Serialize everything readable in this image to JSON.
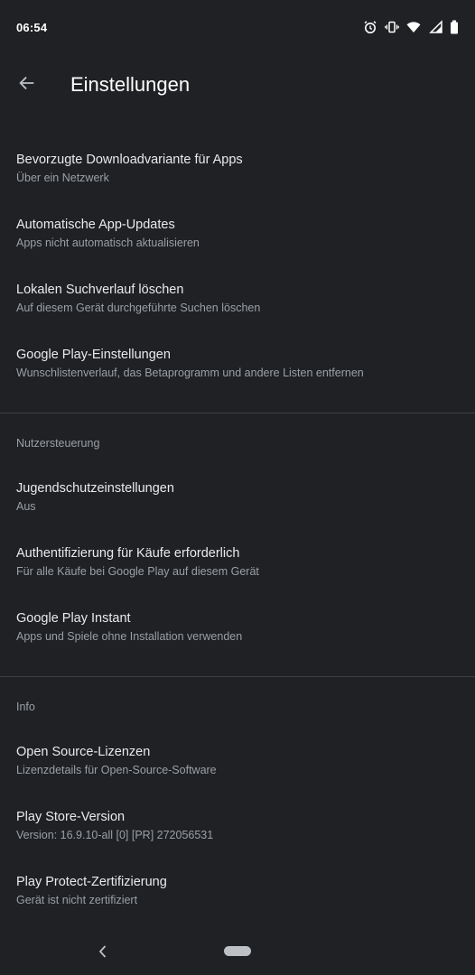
{
  "status_bar": {
    "time": "06:54",
    "icons": [
      "alarm-icon",
      "vibrate-icon",
      "wifi-icon",
      "signal-icon",
      "battery-icon"
    ]
  },
  "app_bar": {
    "title": "Einstellungen",
    "back_icon": "arrow-back-icon"
  },
  "group_general": [
    {
      "title": "Bevorzugte Downloadvariante für Apps",
      "subtitle": "Über ein Netzwerk"
    },
    {
      "title": "Automatische App-Updates",
      "subtitle": "Apps nicht automatisch aktualisieren"
    },
    {
      "title": "Lokalen Suchverlauf löschen",
      "subtitle": "Auf diesem Gerät durchgeführte Suchen löschen"
    },
    {
      "title": "Google Play-Einstellungen",
      "subtitle": "Wunschlistenverlauf, das Betaprogramm und andere Listen entfernen"
    }
  ],
  "section_user_controls": {
    "label": "Nutzersteuerung",
    "items": [
      {
        "title": "Jugendschutzeinstellungen",
        "subtitle": "Aus"
      },
      {
        "title": "Authentifizierung für Käufe erforderlich",
        "subtitle": "Für alle Käufe bei Google Play auf diesem Gerät"
      },
      {
        "title": "Google Play Instant",
        "subtitle": "Apps und Spiele ohne Installation verwenden"
      }
    ]
  },
  "section_info": {
    "label": "Info",
    "items": [
      {
        "title": "Open Source-Lizenzen",
        "subtitle": "Lizenzdetails für Open-Source-Software"
      },
      {
        "title": "Play Store-Version",
        "subtitle": "Version: 16.9.10-all [0] [PR] 272056531"
      },
      {
        "title": "Play Protect-Zertifizierung",
        "subtitle": "Gerät ist nicht zertifiziert"
      }
    ]
  },
  "nav_bar": {
    "back_icon": "nav-back-icon",
    "home_icon": "home-pill-icon"
  },
  "colors": {
    "background": "#202124",
    "primary_text": "#e8eaed",
    "secondary_text": "#9aa0a6",
    "divider": "#3c4043"
  }
}
